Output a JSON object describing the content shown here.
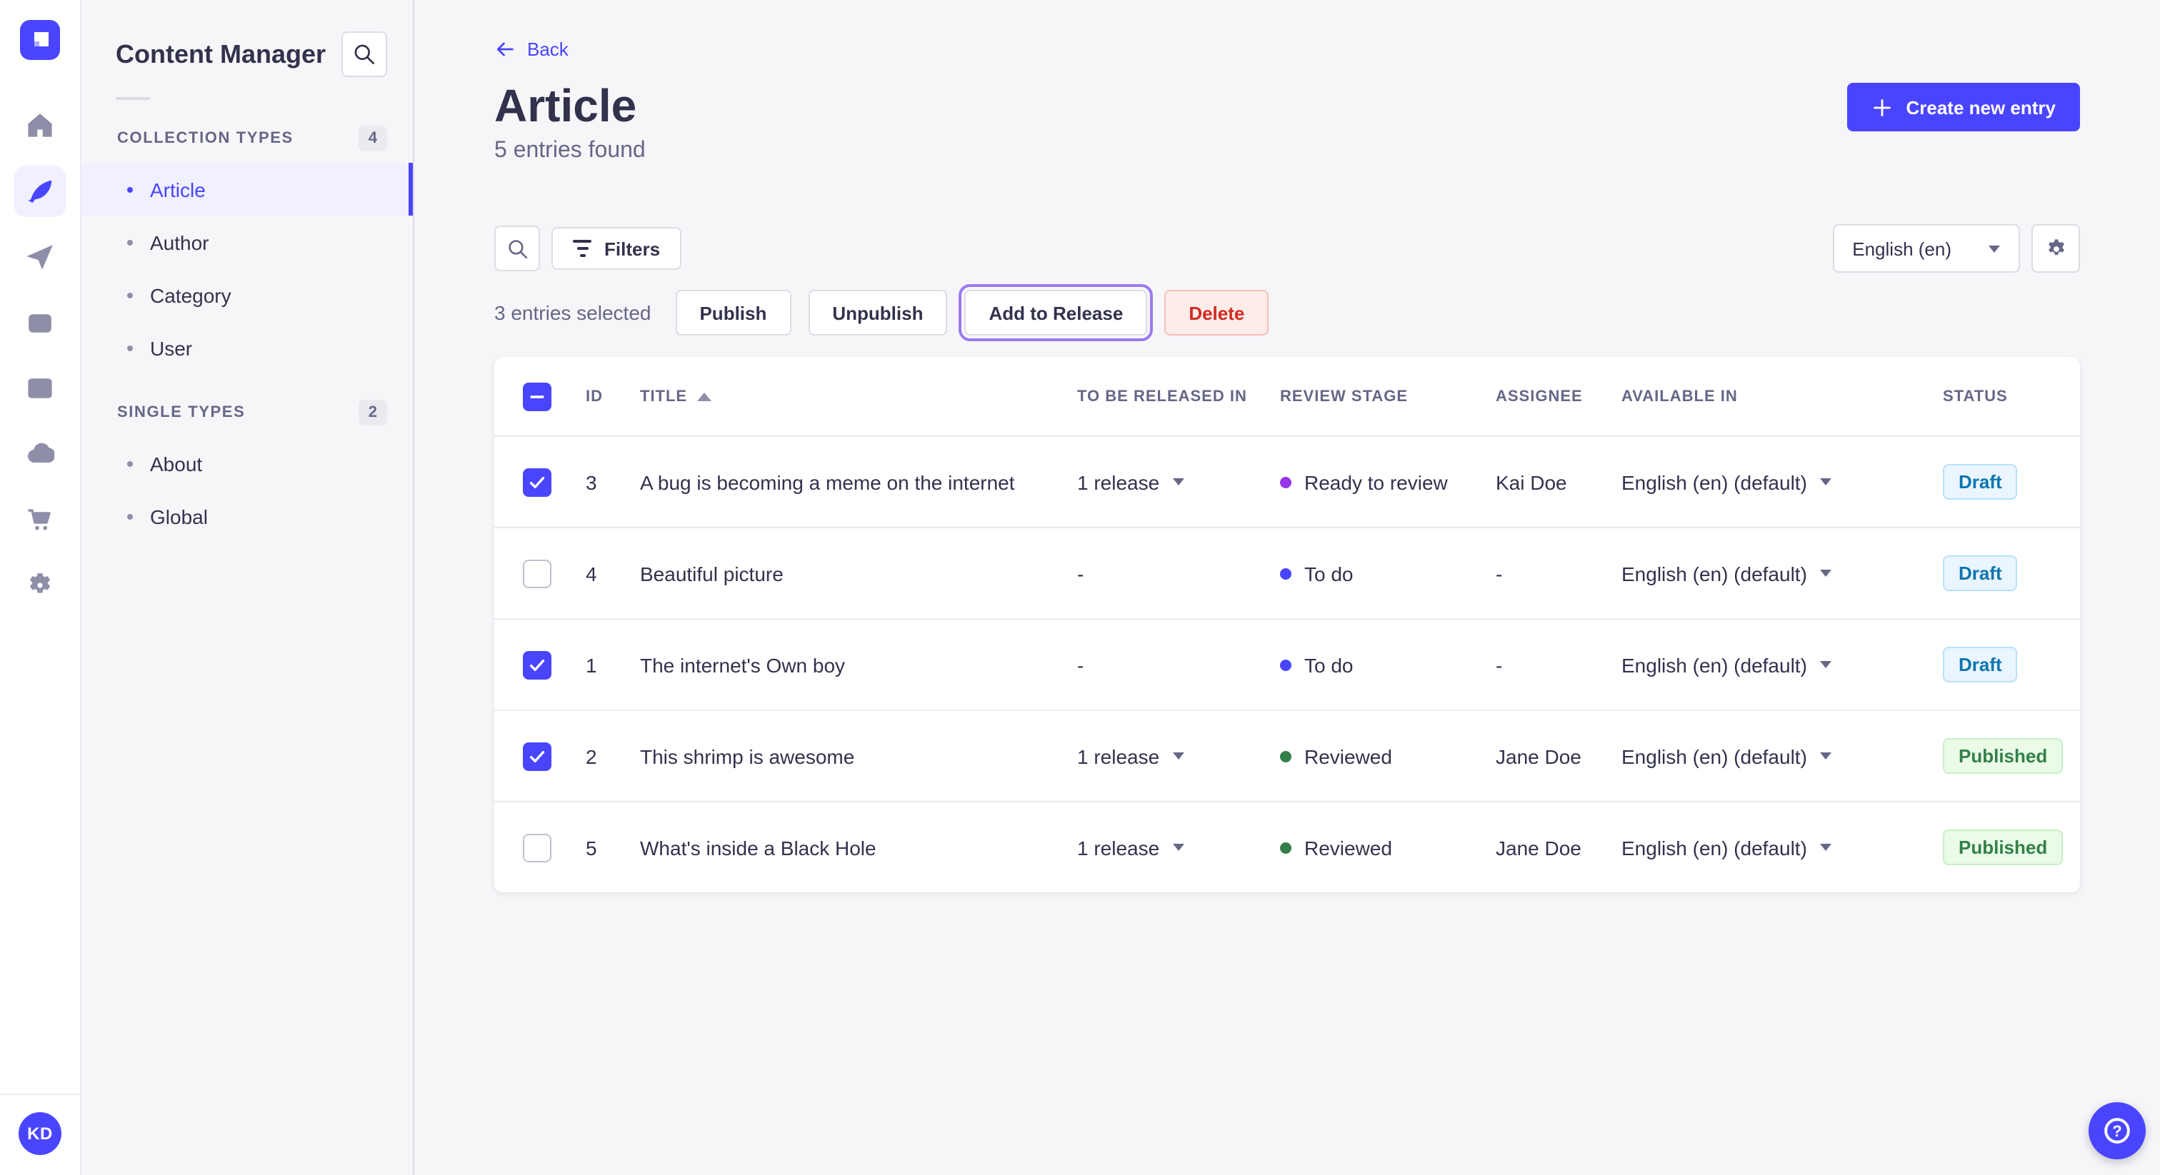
{
  "colors": {
    "primary": "#4945FF",
    "focus_ring": "#9B7AEC",
    "stage_todo": "#4945FF",
    "stage_ready": "#9736E8",
    "stage_reviewed": "#328048"
  },
  "mainnav": {
    "logo_icon": "strapi-logo",
    "items": [
      {
        "name": "home-icon",
        "active": false
      },
      {
        "name": "content-manager-feather-icon",
        "active": true
      },
      {
        "name": "release-paper-plane-icon",
        "active": false
      },
      {
        "name": "media-library-icon",
        "active": false
      },
      {
        "name": "content-type-builder-icon",
        "active": false
      },
      {
        "name": "cloud-icon",
        "active": false
      },
      {
        "name": "marketplace-cart-icon",
        "active": false
      },
      {
        "name": "settings-gear-icon",
        "active": false
      }
    ],
    "user_initials": "KD"
  },
  "subnav": {
    "title": "Content Manager",
    "search_icon": "search-icon",
    "sections": [
      {
        "label": "COLLECTION TYPES",
        "count": "4",
        "items": [
          {
            "label": "Article",
            "active": true
          },
          {
            "label": "Author",
            "active": false
          },
          {
            "label": "Category",
            "active": false
          },
          {
            "label": "User",
            "active": false
          }
        ]
      },
      {
        "label": "SINGLE TYPES",
        "count": "2",
        "items": [
          {
            "label": "About",
            "active": false
          },
          {
            "label": "Global",
            "active": false
          }
        ]
      }
    ]
  },
  "header": {
    "back_label": "Back",
    "title": "Article",
    "subtitle": "5 entries found",
    "create_button_label": "Create new entry"
  },
  "toolbar": {
    "filters_label": "Filters",
    "locale_value": "English (en)"
  },
  "selection": {
    "summary": "3 entries selected",
    "publish_label": "Publish",
    "unpublish_label": "Unpublish",
    "add_to_release_label": "Add to Release",
    "delete_label": "Delete"
  },
  "table": {
    "sort": {
      "column": "TITLE",
      "direction": "asc"
    },
    "columns": {
      "id": "ID",
      "title": "TITLE",
      "release": "TO BE RELEASED IN",
      "stage": "REVIEW STAGE",
      "assignee": "ASSIGNEE",
      "available": "AVAILABLE IN",
      "status": "STATUS"
    },
    "rows": [
      {
        "checked": true,
        "id": "3",
        "title": "A bug is becoming a meme on the internet",
        "release": "1 release",
        "release_caret": true,
        "stage": "Ready to review",
        "stage_color": "#9736E8",
        "assignee": "Kai Doe",
        "available": "English (en) (default)",
        "status": "Draft",
        "status_type": "draft"
      },
      {
        "checked": false,
        "id": "4",
        "title": "Beautiful picture",
        "release": "-",
        "release_caret": false,
        "stage": "To do",
        "stage_color": "#4945FF",
        "assignee": "-",
        "available": "English (en) (default)",
        "status": "Draft",
        "status_type": "draft"
      },
      {
        "checked": true,
        "id": "1",
        "title": "The internet's Own boy",
        "release": "-",
        "release_caret": false,
        "stage": "To do",
        "stage_color": "#4945FF",
        "assignee": "-",
        "available": "English (en) (default)",
        "status": "Draft",
        "status_type": "draft"
      },
      {
        "checked": true,
        "id": "2",
        "title": "This shrimp is awesome",
        "release": "1 release",
        "release_caret": true,
        "stage": "Reviewed",
        "stage_color": "#328048",
        "assignee": "Jane Doe",
        "available": "English (en) (default)",
        "status": "Published",
        "status_type": "published"
      },
      {
        "checked": false,
        "id": "5",
        "title": "What's inside a Black Hole",
        "release": "1 release",
        "release_caret": true,
        "stage": "Reviewed",
        "stage_color": "#328048",
        "assignee": "Jane Doe",
        "available": "English (en) (default)",
        "status": "Published",
        "status_type": "published"
      }
    ]
  },
  "fab": {
    "icon": "question-mark-icon"
  }
}
